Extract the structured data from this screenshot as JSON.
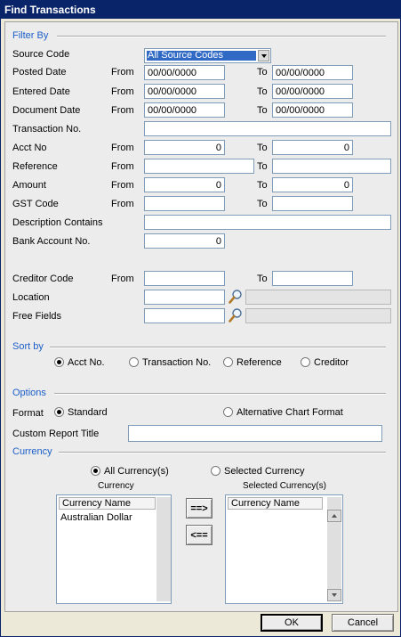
{
  "window": {
    "title": "Find Transactions"
  },
  "filter_by": {
    "section_label": "Filter By",
    "source_code": {
      "label": "Source Code",
      "selected": "All Source Codes"
    },
    "posted_date": {
      "label": "Posted Date",
      "from_label": "From",
      "from": "00/00/0000",
      "to_label": "To",
      "to": "00/00/0000"
    },
    "entered_date": {
      "label": "Entered Date",
      "from_label": "From",
      "from": "00/00/0000",
      "to_label": "To",
      "to": "00/00/0000"
    },
    "document_date": {
      "label": "Document Date",
      "from_label": "From",
      "from": "00/00/0000",
      "to_label": "To",
      "to": "00/00/0000"
    },
    "transaction_no": {
      "label": "Transaction No.",
      "value": ""
    },
    "acct_no": {
      "label": "Acct No",
      "from_label": "From",
      "from": "0",
      "to_label": "To",
      "to": "0"
    },
    "reference": {
      "label": "Reference",
      "from_label": "From",
      "from": "",
      "to_label": "To",
      "to": ""
    },
    "amount": {
      "label": "Amount",
      "from_label": "From",
      "from": "0",
      "to_label": "To",
      "to": "0"
    },
    "gst_code": {
      "label": "GST Code",
      "from_label": "From",
      "from": "",
      "to_label": "To",
      "to": ""
    },
    "description_contains": {
      "label": "Description Contains",
      "value": ""
    },
    "bank_account_no": {
      "label": "Bank Account No.",
      "value": "0"
    },
    "creditor_code": {
      "label": "Creditor Code",
      "from_label": "From",
      "from": "",
      "to_label": "To",
      "to": ""
    },
    "location": {
      "label": "Location",
      "value": "",
      "description": ""
    },
    "free_fields": {
      "label": "Free Fields",
      "value": "",
      "description": ""
    }
  },
  "sort_by": {
    "section_label": "Sort by",
    "options": [
      {
        "label": "Acct No.",
        "selected": true
      },
      {
        "label": "Transaction No.",
        "selected": false
      },
      {
        "label": "Reference",
        "selected": false
      },
      {
        "label": "Creditor",
        "selected": false
      }
    ]
  },
  "options": {
    "section_label": "Options",
    "format_label": "Format",
    "format_standard": {
      "label": "Standard",
      "selected": true
    },
    "format_alternative": {
      "label": "Alternative Chart Format",
      "selected": false
    },
    "custom_report_title": {
      "label": "Custom Report Title",
      "value": ""
    }
  },
  "currency": {
    "section_label": "Currency",
    "all_currencies": {
      "label": "All Currency(s)",
      "selected": true
    },
    "selected_currency": {
      "label": "Selected Currency",
      "selected": false
    },
    "available_caption": "Currency",
    "selected_caption": "Selected Currency(s)",
    "available_header": "Currency Name",
    "available_items": [
      "Australian Dollar"
    ],
    "selected_header": "Currency Name",
    "selected_items": [],
    "add_button": "==>",
    "remove_button": "<=="
  },
  "footer": {
    "ok": "OK",
    "cancel": "Cancel"
  },
  "colors": {
    "title_bar": "#0a246a",
    "section_label": "#1c5ec8",
    "selection": "#316ac5",
    "window_bg": "#ececec"
  }
}
